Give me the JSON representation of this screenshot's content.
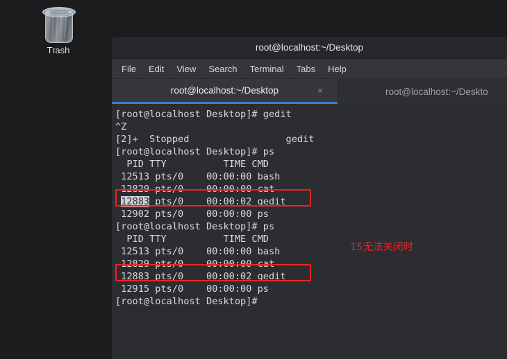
{
  "desktop": {
    "trash": {
      "label": "Trash",
      "icon": "trash-bin-icon"
    },
    "background_color": "#1c1c1e"
  },
  "window": {
    "title": "root@localhost:~/Desktop",
    "menu": [
      {
        "label": "File"
      },
      {
        "label": "Edit"
      },
      {
        "label": "View"
      },
      {
        "label": "Search"
      },
      {
        "label": "Terminal"
      },
      {
        "label": "Tabs"
      },
      {
        "label": "Help"
      }
    ],
    "tabs": [
      {
        "label": "root@localhost:~/Desktop",
        "active": true,
        "close_icon": "×"
      },
      {
        "label": "root@localhost:~/Deskto",
        "active": false
      }
    ],
    "accent_color": "#3b7cd4"
  },
  "terminal": {
    "prompt": "[root@localhost Desktop]#",
    "lines": [
      "[root@localhost Desktop]# gedit",
      "^Z",
      "[2]+  Stopped                 gedit",
      "[root@localhost Desktop]# ps",
      "  PID TTY          TIME CMD",
      " 12513 pts/0    00:00:00 bash",
      " 12829 pts/0    00:00:00 cat",
      " 12883 pts/0    00:00:02 gedit",
      " 12902 pts/0    00:00:00 ps",
      "[root@localhost Desktop]# ps",
      "  PID TTY          TIME CMD",
      " 12513 pts/0    00:00:00 bash",
      " 12829 pts/0    00:00:00 cat",
      " 12883 pts/0    00:00:02 gedit",
      " 12915 pts/0    00:00:00 ps",
      "[root@localhost Desktop]#"
    ],
    "selected_text": "12883",
    "text_color": "#d9dadb",
    "background_color": "#2b2d30"
  },
  "annotations": {
    "note_text": "15无法关闭时",
    "note_color": "#ee2222",
    "highlight_boxes": [
      {
        "target_line": " 12883 pts/0    00:00:02 gedit",
        "index": 1
      },
      {
        "target_line": " 12883 pts/0    00:00:02 gedit",
        "index": 2
      }
    ]
  }
}
